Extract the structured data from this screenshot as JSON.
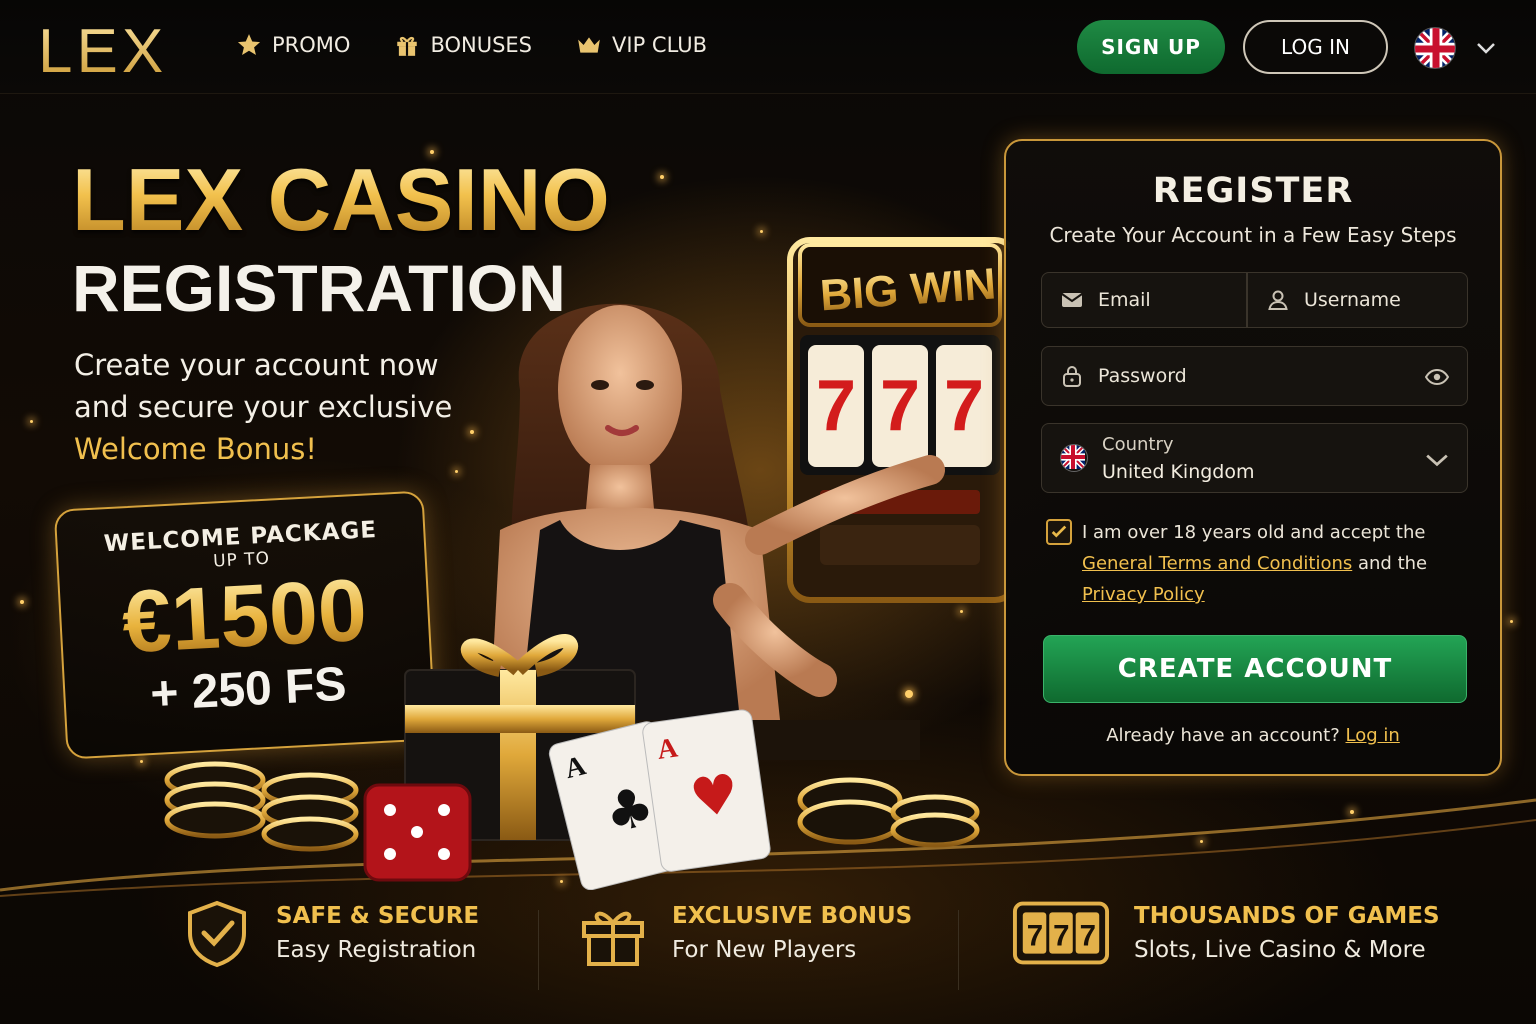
{
  "brand": {
    "logo": "LEX"
  },
  "nav": [
    {
      "label": "PROMO",
      "icon": "star-icon"
    },
    {
      "label": "BONUSES",
      "icon": "gift-icon"
    },
    {
      "label": "VIP CLUB",
      "icon": "crown-icon"
    }
  ],
  "header": {
    "signup_label": "SIGN UP",
    "login_label": "LOG IN",
    "language_icon": "uk-flag-icon"
  },
  "hero": {
    "title": "LEX CASINO",
    "subtitle": "REGISTRATION",
    "desc_line": "Create your account now and secure your exclusive",
    "desc_highlight": "Welcome Bonus!"
  },
  "welcome": {
    "line1": "WELCOME PACKAGE",
    "line2": "UP TO",
    "amount": "€1500",
    "free_spins": "+ 250 FS"
  },
  "illustration": {
    "sign_text": "BIG WIN",
    "reel_symbol": "7"
  },
  "register": {
    "title": "REGISTER",
    "subtitle": "Create Your Account in a Few Easy Steps",
    "email_placeholder": "Email",
    "username_placeholder": "Username",
    "password_placeholder": "Password",
    "country_label": "Country",
    "country_value": "United Kingdom",
    "terms_prefix": "I am over 18 years old and accept the",
    "terms_link": "General Terms and Conditions",
    "terms_mid": "and the",
    "privacy_link": "Privacy Policy",
    "create_label": "CREATE ACCOUNT",
    "already_text": "Already have an account?",
    "login_link": "Log in",
    "terms_checked": true
  },
  "features": [
    {
      "title": "SAFE & SECURE",
      "subtitle": "Easy Registration",
      "icon": "shield-check-icon"
    },
    {
      "title": "EXCLUSIVE BONUS",
      "subtitle": "For New Players",
      "icon": "gift-icon"
    },
    {
      "title": "THOUSANDS OF GAMES",
      "subtitle": "Slots, Live Casino & More",
      "icon": "slot-777-icon"
    }
  ],
  "colors": {
    "gold": "#f1c04e",
    "green": "#1f8a44",
    "panel_border": "#c9973a",
    "background": "#050403"
  }
}
